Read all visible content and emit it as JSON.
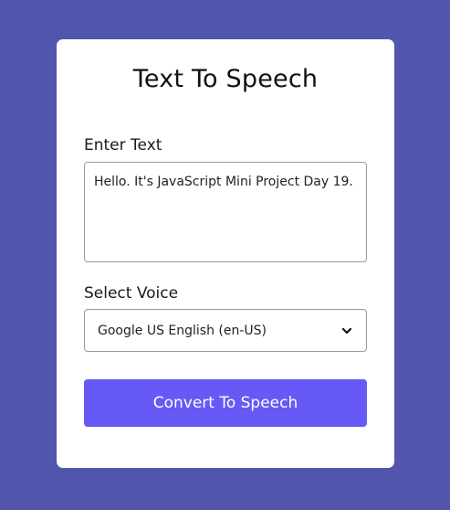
{
  "app": {
    "title": "Text To Speech"
  },
  "form": {
    "text_label": "Enter Text",
    "text_value": "Hello. It's JavaScript Mini Project Day 19.",
    "voice_label": "Select Voice",
    "voice_selected": "Google US English (en-US)",
    "convert_button_label": "Convert To Speech"
  },
  "icons": {
    "select_arrow": "chevron-down-icon"
  },
  "colors": {
    "page_background": "#5156AC",
    "card_background": "#FFFFFF",
    "button_background": "#6659F5",
    "button_text": "#FFFFFF"
  }
}
